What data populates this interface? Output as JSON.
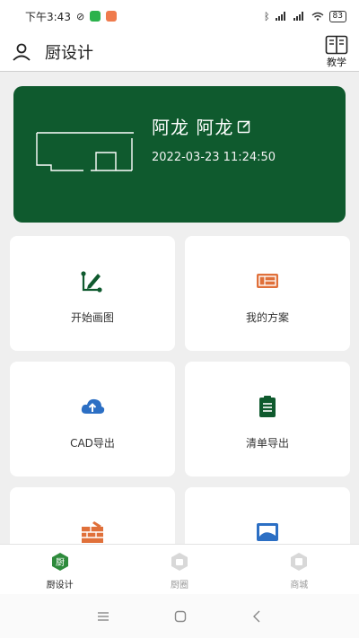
{
  "status": {
    "time": "下午3:43",
    "battery": "83"
  },
  "header": {
    "title": "厨设计",
    "teach_label": "教学"
  },
  "hero": {
    "name": "阿龙 阿龙",
    "datetime": "2022-03-23 11:24:50"
  },
  "menu": [
    {
      "label": "开始画图",
      "icon": "draw-icon"
    },
    {
      "label": "我的方案",
      "icon": "blueprint-icon"
    },
    {
      "label": "CAD导出",
      "icon": "cloud-upload-icon"
    },
    {
      "label": "清单导出",
      "icon": "clipboard-list-icon"
    },
    {
      "label": "",
      "icon": "brick-wall-icon"
    },
    {
      "label": "",
      "icon": "image-icon"
    }
  ],
  "tabs": [
    {
      "label": "厨设计",
      "active": true
    },
    {
      "label": "厨圈",
      "active": false
    },
    {
      "label": "商城",
      "active": false
    }
  ],
  "colors": {
    "brand_green": "#0f5a2e",
    "accent_orange": "#e0703a",
    "accent_blue": "#2c6fc4"
  }
}
